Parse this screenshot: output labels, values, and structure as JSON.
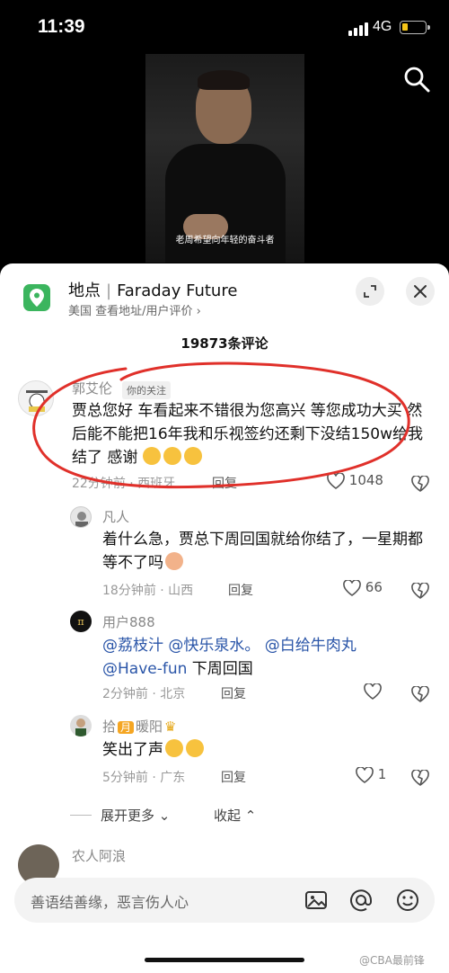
{
  "status": {
    "time": "11:39",
    "network": "4G"
  },
  "video": {
    "subtitle": "老周希望向年轻的奋斗者"
  },
  "location": {
    "label": "地点",
    "name": "Faraday Future",
    "subtitle": "美国  查看地址/用户评价 ›"
  },
  "comment_count": "19873条评论",
  "comments": [
    {
      "name": "郭艾伦",
      "tag": "你的关注",
      "text": "贾总您好 车看起来不错很为您高兴 等您成功大买 然后能不能把16年我和乐视签约还剩下没结150w给我结了 感谢",
      "time": "22分钟前 · 西班牙",
      "reply": "回复",
      "likes": "1048"
    },
    {
      "name": "凡人",
      "text": "着什么急，贾总下周回国就给你结了，一星期都等不了吗",
      "time": "18分钟前 · 山西",
      "reply": "回复",
      "likes": "66"
    },
    {
      "name": "用户888",
      "mention1": "@荔枝汁 @快乐泉水。 @白给牛肉丸",
      "mention2": "@Have-fun",
      "tail": " 下周回国",
      "time": "2分钟前 · 北京",
      "reply": "回复",
      "likes": ""
    },
    {
      "name_a": "拾",
      "name_badge": "月",
      "name_b": "暖阳",
      "text": "笑出了声",
      "time": "5分钟前 · 广东",
      "reply": "回复",
      "likes": "1"
    }
  ],
  "expand_more": "展开更多",
  "collapse": "收起",
  "next_comment_name": "农人阿浪",
  "input_placeholder": "善语结善缘，恶言伤人心",
  "watermark": "@CBA最前锋",
  "colors": {
    "accent_green": "#3bb55e",
    "mention": "#2a55a8",
    "annotation": "#e0302a"
  }
}
